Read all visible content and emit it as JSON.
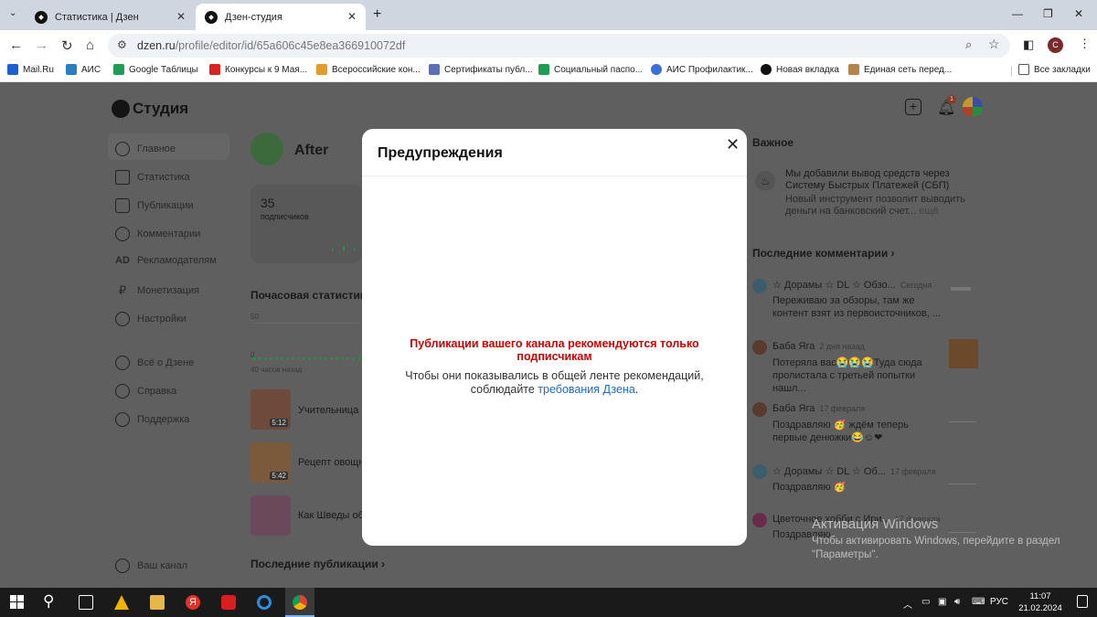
{
  "browser": {
    "tabs": [
      {
        "title": "Статистика | Дзен"
      },
      {
        "title": "Дзен-студия"
      }
    ],
    "url_host": "dzen.ru",
    "url_path": "/profile/editor/id/65a606c45e8ea366910072df",
    "profile_letter": "C",
    "bookmarks": [
      "Mail.Ru",
      "АИС",
      "Google Таблицы",
      "Конкурсы к 9 Мая...",
      "Всероссийские кон...",
      "Сертификаты публ...",
      "Социальный паспо...",
      "АИС Профилактик...",
      "Новая вкладка",
      "Единая сеть перед..."
    ],
    "all_bookmarks": "Все закладки"
  },
  "studio": {
    "logo": "Студия",
    "sidebar": [
      "Главное",
      "Статистика",
      "Публикации",
      "Комментарии",
      "Рекламодателям",
      "Монетизация",
      "Настройки",
      "Всё о Дзене",
      "Справка",
      "Поддержка"
    ],
    "sidebar_icons": {
      "ad": "AD",
      "ruble": "₽"
    },
    "channel_link": "Ваш канал",
    "channel_name": "After",
    "subscribers_count": "35",
    "subscribers_label": "подписчиков",
    "hourly_stats": "Почасовая статистик",
    "chart_max": "50",
    "chart_min": "0",
    "chart_xlabel": "40 часов назад",
    "publications": [
      {
        "title": "Учительница п",
        "duration": "5:12"
      },
      {
        "title": "Рецепт овощн",
        "duration": "5:42"
      },
      {
        "title": "Как Шведы об",
        "duration": ""
      }
    ],
    "recent_publications": "Последние публикации",
    "notification_count": "1",
    "important": {
      "heading": "Важное",
      "title": "Мы добавили вывод средств через Систему Быстрых Платежей (СБП)",
      "body": "Новый инструмент позволит выводить деньги на банковский счет...",
      "more": "ещё"
    },
    "comments_heading": "Последние комментарии",
    "comments": [
      {
        "author": "☆ Дорамы ☆ DL ☆ Обзо...",
        "date": "Сегодня",
        "text": "Переживаю за обзоры, там же контент взят из первоисточников, ..."
      },
      {
        "author": "Баба Яга",
        "date": "2 дня назад",
        "text": "Потеряла вас😭😭😭Туда сюда пролистала с третьей попытки нашл..."
      },
      {
        "author": "Баба Яга",
        "date": "17 февраля",
        "text": "Поздравляю 🥳 ждём теперь первые денюжки😂☺❤"
      },
      {
        "author": "☆ Дорамы ☆ DL ☆ Об...",
        "date": "17 февраля",
        "text": "Поздравляю 🥳"
      },
      {
        "author": "Цветочное хобби с Ири...",
        "date": "17 февраля",
        "text": "Поздравляю"
      }
    ]
  },
  "modal": {
    "title": "Предупреждения",
    "warning": "Публикации вашего канала рекомендуются только подписчикам",
    "text_before": "Чтобы они показывались в общей ленте рекомендаций, соблюдайте ",
    "link": "требования Дзена",
    "text_after": "."
  },
  "watermark": {
    "title": "Активация Windows",
    "text": "Чтобы активировать Windows, перейдите в раздел \"Параметры\"."
  },
  "taskbar": {
    "lang": "РУС",
    "time": "11:07",
    "date": "21.02.2024"
  },
  "colors": {
    "warning": "#d40000",
    "link": "#1a6ad4",
    "overlay": "#5f5f5f"
  }
}
